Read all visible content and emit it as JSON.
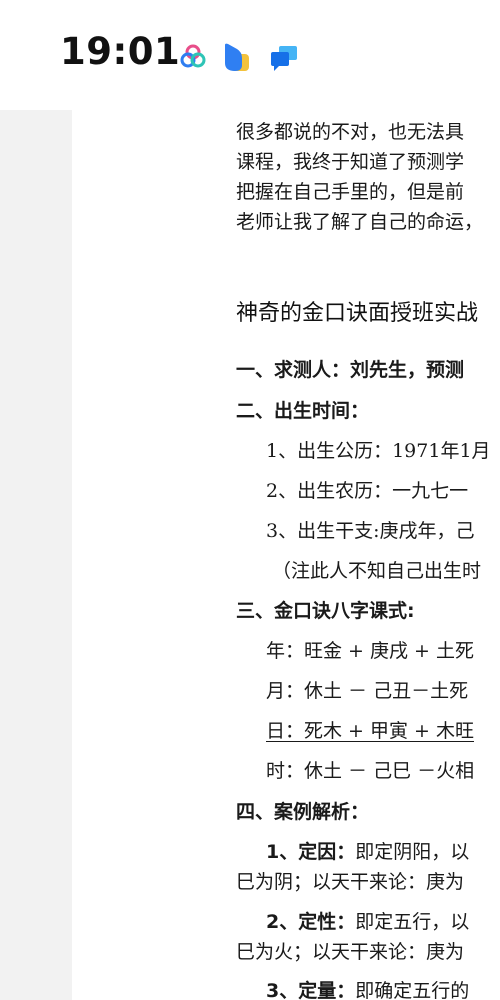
{
  "status_bar": {
    "time": "19:01",
    "icons": [
      "colorful-circles-app-icon",
      "blue-yellow-app-icon",
      "blue-chat-app-icon"
    ]
  },
  "document": {
    "intro": [
      "很多都说的不对，也无法具",
      "课程，我终于知道了预测学",
      "把握在自己手里的，但是前",
      "老师让我了解了自己的命运，"
    ],
    "heading": "神奇的金口诀面授班实战",
    "s1": "一、求测人：刘先生，预测",
    "s2": "二、出生时间：",
    "s2_items": [
      "1、出生公历：1971年1月",
      "2、出生农历：一九七一",
      "3、出生干支:庚戌年，己",
      "（注此人不知自己出生时"
    ],
    "s3": "三、金口诀八字课式:",
    "s3_rows": [
      "年：旺金 + 庚戌 + 土死",
      "月：休土 － 己丑－土死",
      "日：死木 + 甲寅 + 木旺",
      "时：休土 － 己巳 －火相"
    ],
    "s4": "四、案例解析：",
    "p1_term": "1、定因：",
    "p1_a": "即定阴阳，以",
    "p1_b": "巳为阴；以天干来论：庚为",
    "p2_term": "2、定性：",
    "p2_a": "即定五行，以",
    "p2_b": "巳为火；以天干来论：庚为",
    "p3_term": "3、定量：",
    "p3_a": "即确定五行的"
  }
}
